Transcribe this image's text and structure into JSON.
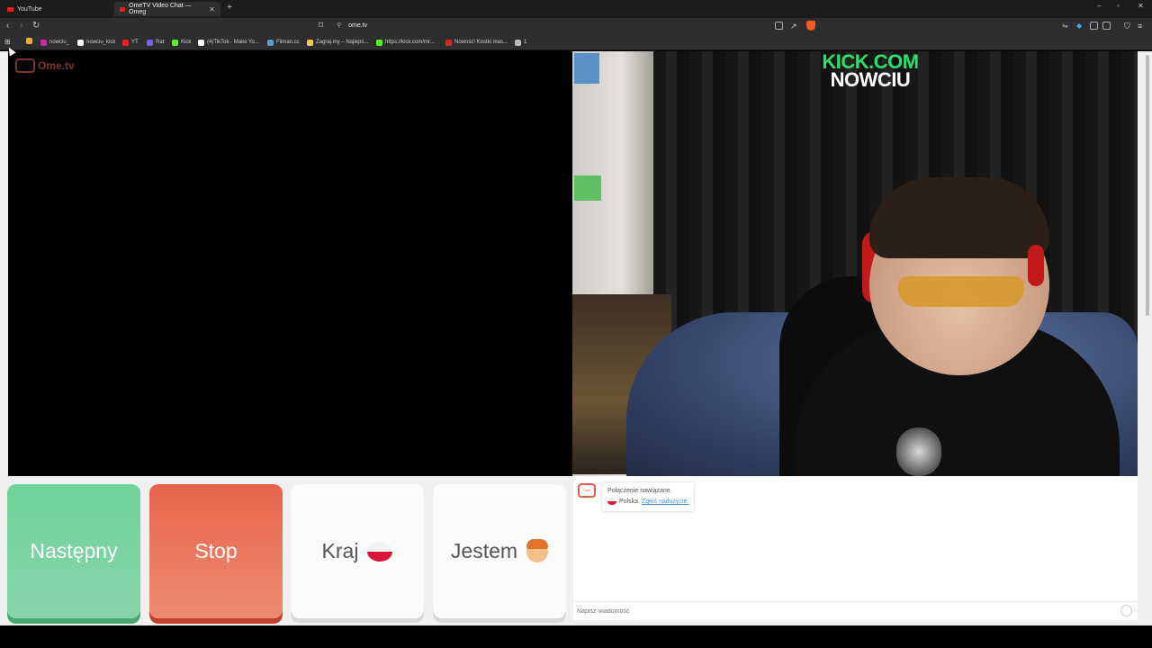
{
  "browser": {
    "tabs": [
      {
        "label": "YouTube",
        "active": false
      },
      {
        "label": "OmeTV Video Chat — Omeg",
        "active": true
      }
    ],
    "new_tab": "+",
    "window_controls": [
      "–",
      "▫",
      "✕"
    ],
    "address": "ome.tv",
    "bookmarks": [
      {
        "label": "",
        "color": "#f4a637"
      },
      {
        "label": "nowciu_",
        "color": "#d6249f"
      },
      {
        "label": "nowciu_kick",
        "color": "#ffffff"
      },
      {
        "label": "YT",
        "color": "#e62117"
      },
      {
        "label": "Rat",
        "color": "#7b5cf5"
      },
      {
        "label": "Kick",
        "color": "#53fc18"
      },
      {
        "label": "(4)TikTok - Make Yo...",
        "color": "#ffffff"
      },
      {
        "label": "Filman.cc",
        "color": "#4aa3df"
      },
      {
        "label": "Zagraj.my – Najleps...",
        "color": "#f2c94c"
      },
      {
        "label": "https://kick.com/mr...",
        "color": "#53fc18"
      },
      {
        "label": "Nowość! Kostki mas...",
        "color": "#e62117"
      },
      {
        "label": "1",
        "color": "#bbbbbb"
      }
    ]
  },
  "page": {
    "logo_text": "Ome.tv",
    "overlay_line1": "KICK.COM",
    "overlay_line2": "NOWCIU",
    "buttons": {
      "next": "Następny",
      "stop": "Stop",
      "country": "Kraj",
      "gender": "Jestem"
    },
    "chat": {
      "logo_text": "Ome",
      "status": "Połączenie nawiązane.",
      "country": "Polska.",
      "report_link": "Zgłoś nadużycie.",
      "input_placeholder": "Napisz wiadomość"
    }
  },
  "colors": {
    "next_button": "#6fd39a",
    "stop_button": "#e8644c",
    "overlay_green": "#2be06a",
    "brand": "#e8604c"
  }
}
